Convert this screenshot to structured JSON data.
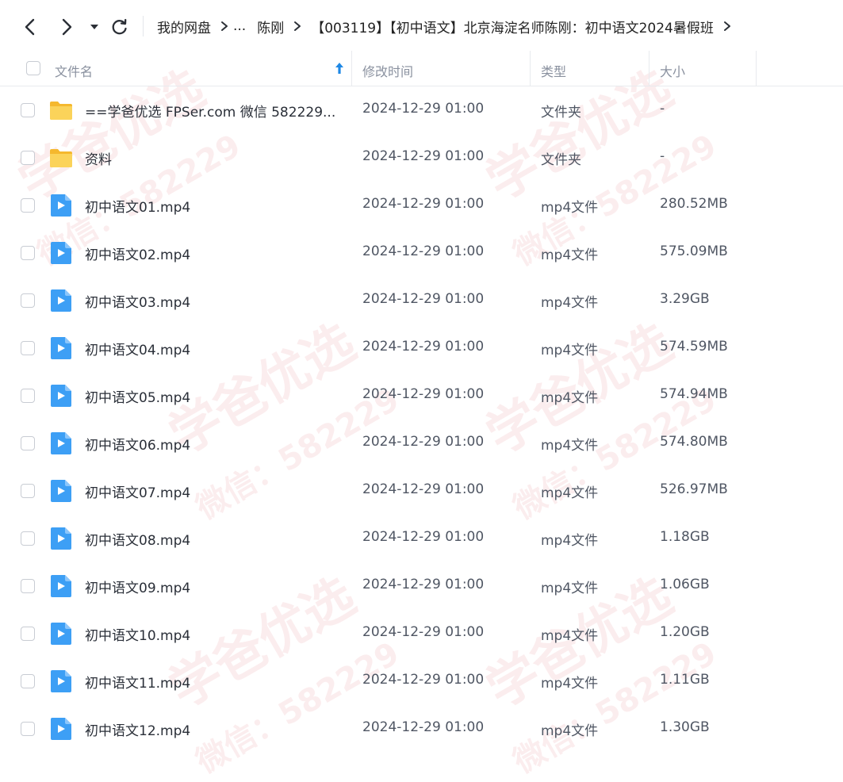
{
  "toolbar": {
    "breadcrumb": [
      "我的网盘",
      "...",
      "陈刚",
      "【003119】【初中语文】北京海淀名师陈刚：初中语文2024暑假班"
    ]
  },
  "header": {
    "name": "文件名",
    "modified": "修改时间",
    "type": "类型",
    "size": "大小"
  },
  "files": [
    {
      "name": "==学爸优选 FPSer.com 微信 582229...",
      "modified": "2024-12-29 01:00",
      "type": "文件夹",
      "size": "-",
      "icon": "folder-icon"
    },
    {
      "name": "资料",
      "modified": "2024-12-29 01:00",
      "type": "文件夹",
      "size": "-",
      "icon": "folder-icon"
    },
    {
      "name": "初中语文01.mp4",
      "modified": "2024-12-29 01:00",
      "type": "mp4文件",
      "size": "280.52MB",
      "icon": "video-file-icon"
    },
    {
      "name": "初中语文02.mp4",
      "modified": "2024-12-29 01:00",
      "type": "mp4文件",
      "size": "575.09MB",
      "icon": "video-file-icon"
    },
    {
      "name": "初中语文03.mp4",
      "modified": "2024-12-29 01:00",
      "type": "mp4文件",
      "size": "3.29GB",
      "icon": "video-file-icon"
    },
    {
      "name": "初中语文04.mp4",
      "modified": "2024-12-29 01:00",
      "type": "mp4文件",
      "size": "574.59MB",
      "icon": "video-file-icon"
    },
    {
      "name": "初中语文05.mp4",
      "modified": "2024-12-29 01:00",
      "type": "mp4文件",
      "size": "574.94MB",
      "icon": "video-file-icon"
    },
    {
      "name": "初中语文06.mp4",
      "modified": "2024-12-29 01:00",
      "type": "mp4文件",
      "size": "574.80MB",
      "icon": "video-file-icon"
    },
    {
      "name": "初中语文07.mp4",
      "modified": "2024-12-29 01:00",
      "type": "mp4文件",
      "size": "526.97MB",
      "icon": "video-file-icon"
    },
    {
      "name": "初中语文08.mp4",
      "modified": "2024-12-29 01:00",
      "type": "mp4文件",
      "size": "1.18GB",
      "icon": "video-file-icon"
    },
    {
      "name": "初中语文09.mp4",
      "modified": "2024-12-29 01:00",
      "type": "mp4文件",
      "size": "1.06GB",
      "icon": "video-file-icon"
    },
    {
      "name": "初中语文10.mp4",
      "modified": "2024-12-29 01:00",
      "type": "mp4文件",
      "size": "1.20GB",
      "icon": "video-file-icon"
    },
    {
      "name": "初中语文11.mp4",
      "modified": "2024-12-29 01:00",
      "type": "mp4文件",
      "size": "1.11GB",
      "icon": "video-file-icon"
    },
    {
      "name": "初中语文12.mp4",
      "modified": "2024-12-29 01:00",
      "type": "mp4文件",
      "size": "1.30GB",
      "icon": "video-file-icon"
    }
  ],
  "watermark": {
    "line1": "学爸优选",
    "line2": "微信：582229"
  },
  "colors": {
    "accent": "#1e88e5",
    "folder": "#f7c53a",
    "video": "#3d9ff5"
  }
}
